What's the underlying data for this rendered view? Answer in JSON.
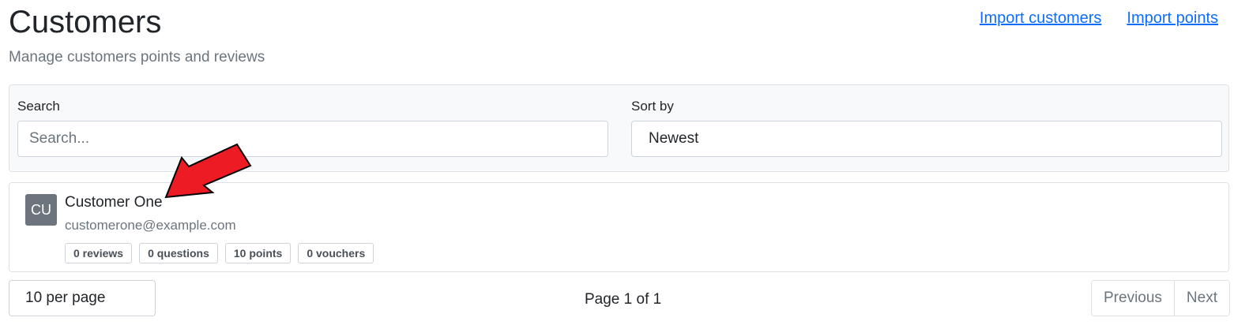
{
  "header": {
    "title": "Customers",
    "subtitle": "Manage customers points and reviews",
    "links": [
      "Import customers",
      "Import points"
    ]
  },
  "filters": {
    "search_label": "Search",
    "search_placeholder": "Search...",
    "search_value": "",
    "sort_label": "Sort by",
    "sort_value": "Newest"
  },
  "customers": [
    {
      "initials": "CU",
      "name": "Customer One",
      "email": "customerone@example.com",
      "badges": [
        "0 reviews",
        "0 questions",
        "10 points",
        "0 vouchers"
      ]
    }
  ],
  "pagination": {
    "per_page": "10 per page",
    "page_info": "Page 1 of 1",
    "previous_label": "Previous",
    "next_label": "Next"
  },
  "annotation": {
    "arrow_color": "#ed1c24",
    "arrow_outline": "#000000"
  }
}
